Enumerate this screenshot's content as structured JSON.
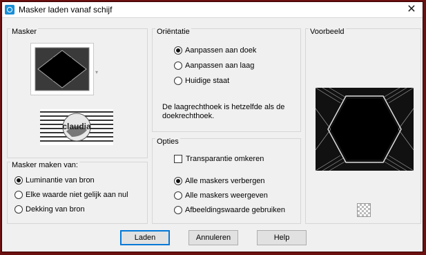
{
  "window": {
    "title": "Masker laden vanaf schijf",
    "close_glyph": "✕"
  },
  "masker": {
    "label": "Masker",
    "watermark_text": "claudia"
  },
  "source": {
    "label": "Masker maken van:",
    "options": [
      {
        "label": "Luminantie van bron",
        "selected": true
      },
      {
        "label": "Elke waarde niet gelijk aan nul",
        "selected": false
      },
      {
        "label": "Dekking van bron",
        "selected": false
      }
    ]
  },
  "orientation": {
    "label": "Oriëntatie",
    "options": [
      {
        "label": "Aanpassen aan doek",
        "selected": true
      },
      {
        "label": "Aanpassen aan laag",
        "selected": false
      },
      {
        "label": "Huidige staat",
        "selected": false
      }
    ],
    "note": "De laagrechthoek is hetzelfde als de doekrechthoek."
  },
  "options": {
    "label": "Opties",
    "invert_label": "Transparantie omkeren",
    "invert_checked": false,
    "radios": [
      {
        "label": "Alle maskers verbergen",
        "selected": true
      },
      {
        "label": "Alle maskers weergeven",
        "selected": false
      },
      {
        "label": "Afbeeldingswaarde gebruiken",
        "selected": false
      }
    ]
  },
  "preview": {
    "label": "Voorbeeld"
  },
  "buttons": {
    "load": "Laden",
    "cancel": "Annuleren",
    "help": "Help"
  }
}
